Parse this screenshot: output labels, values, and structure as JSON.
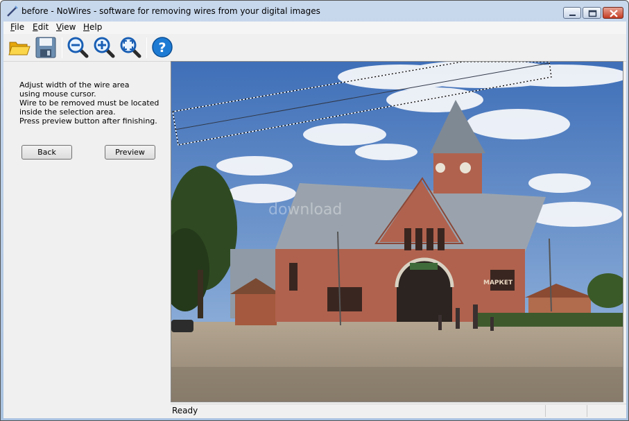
{
  "window": {
    "title": "before - NoWires - software for removing wires from your digital images"
  },
  "menu": {
    "items": [
      {
        "label": "File",
        "mnemonic": "F",
        "rest": "ile"
      },
      {
        "label": "Edit",
        "mnemonic": "E",
        "rest": "dit"
      },
      {
        "label": "View",
        "mnemonic": "V",
        "rest": "iew"
      },
      {
        "label": "Help",
        "mnemonic": "H",
        "rest": "elp"
      }
    ]
  },
  "toolbar": {
    "buttons": [
      "open-folder-icon",
      "save-icon",
      "zoom-out-icon",
      "zoom-in-icon",
      "zoom-fit-icon",
      "help-icon"
    ]
  },
  "panel": {
    "instructions": [
      "Adjust width of the wire area",
      "using mouse cursor.",
      "Wire to be removed must be located",
      "inside the selection area.",
      "Press preview button after finishing."
    ],
    "back_label": "Back",
    "preview_label": "Preview"
  },
  "image": {
    "watermark": "download",
    "shop_sign": "МАРКЕТ"
  },
  "status": {
    "text": "Ready"
  },
  "colors": {
    "sky": "#5a84c3",
    "brick": "#b0624e",
    "roof": "#9aa3ad",
    "ground": "#a89a88"
  }
}
